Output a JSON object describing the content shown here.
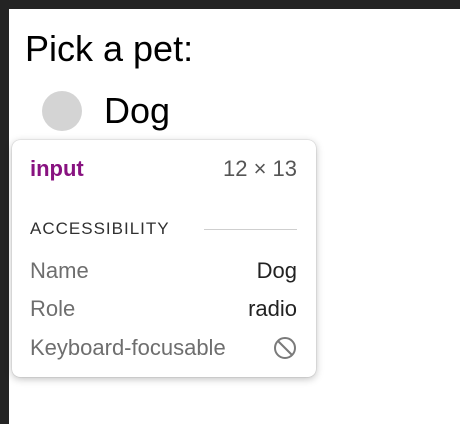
{
  "page": {
    "question": "Pick a pet:",
    "radio_label": "Dog"
  },
  "inspector": {
    "tag": "input",
    "size": "12 × 13",
    "section_title": "ACCESSIBILITY",
    "rows": [
      {
        "key": "Name",
        "value": "Dog"
      },
      {
        "key": "Role",
        "value": "radio"
      },
      {
        "key": "Keyboard-focusable",
        "icon": "not-allowed-icon"
      }
    ]
  },
  "colors": {
    "tag": "#881280",
    "radio": "#d4d4d4",
    "chrome_strip": "#242424"
  }
}
